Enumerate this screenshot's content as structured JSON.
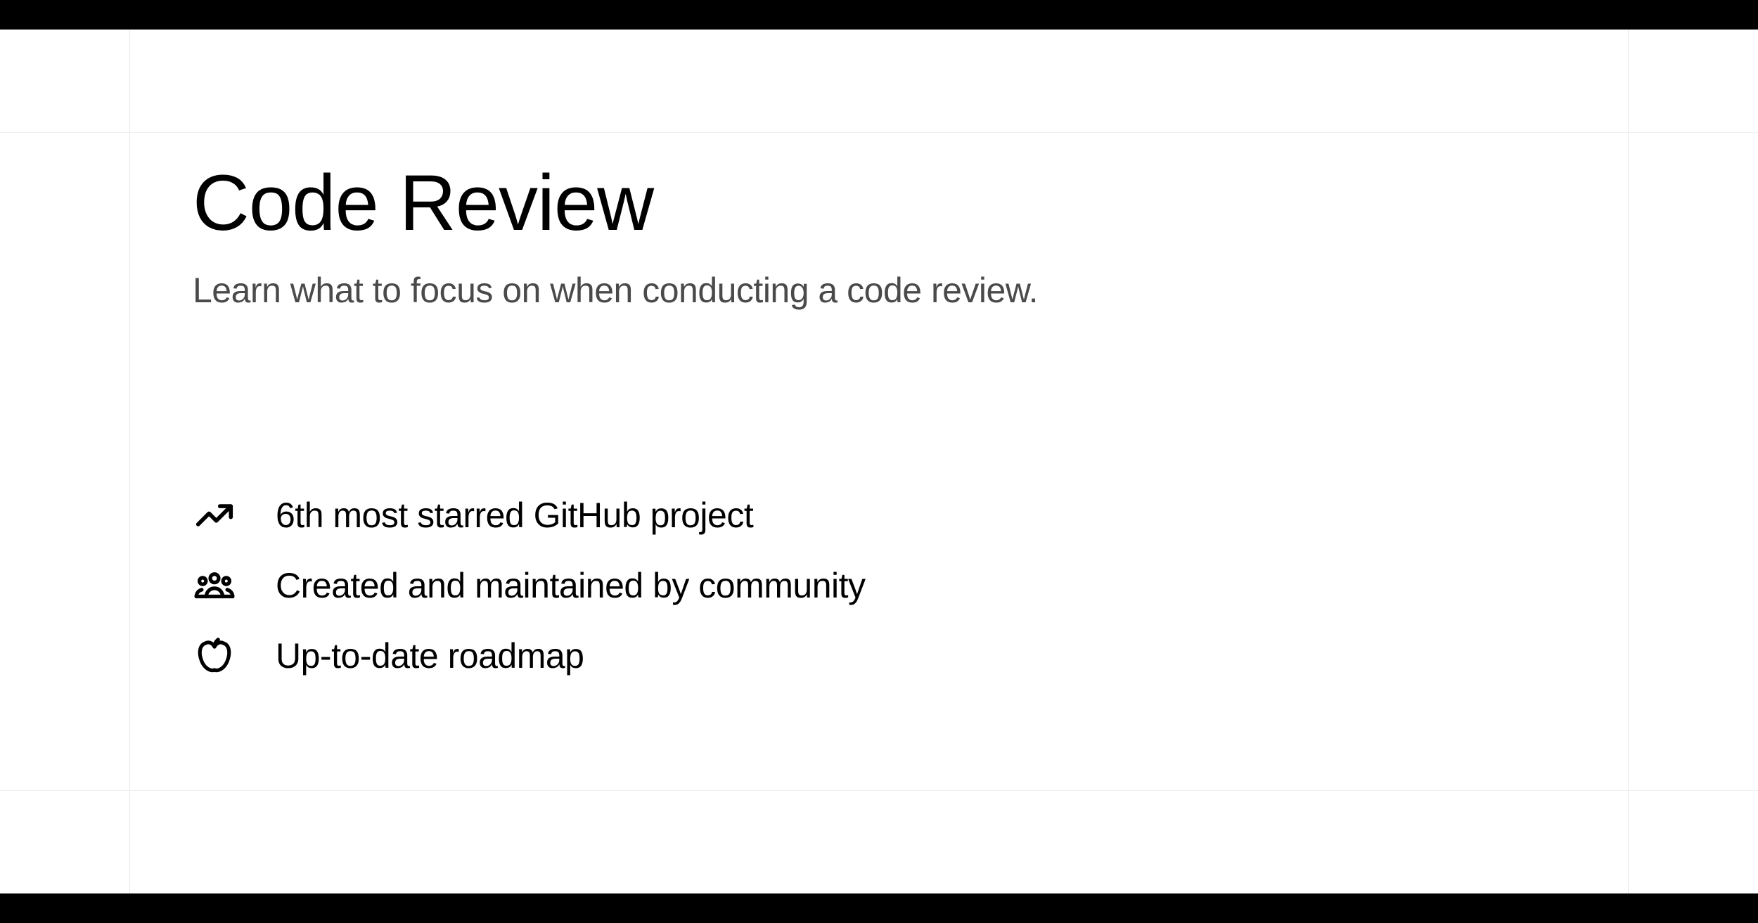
{
  "title": "Code Review",
  "subtitle": "Learn what to focus on when conducting a code review.",
  "features": [
    {
      "text": "6th most starred GitHub project"
    },
    {
      "text": "Created and maintained by community"
    },
    {
      "text": "Up-to-date roadmap"
    }
  ]
}
